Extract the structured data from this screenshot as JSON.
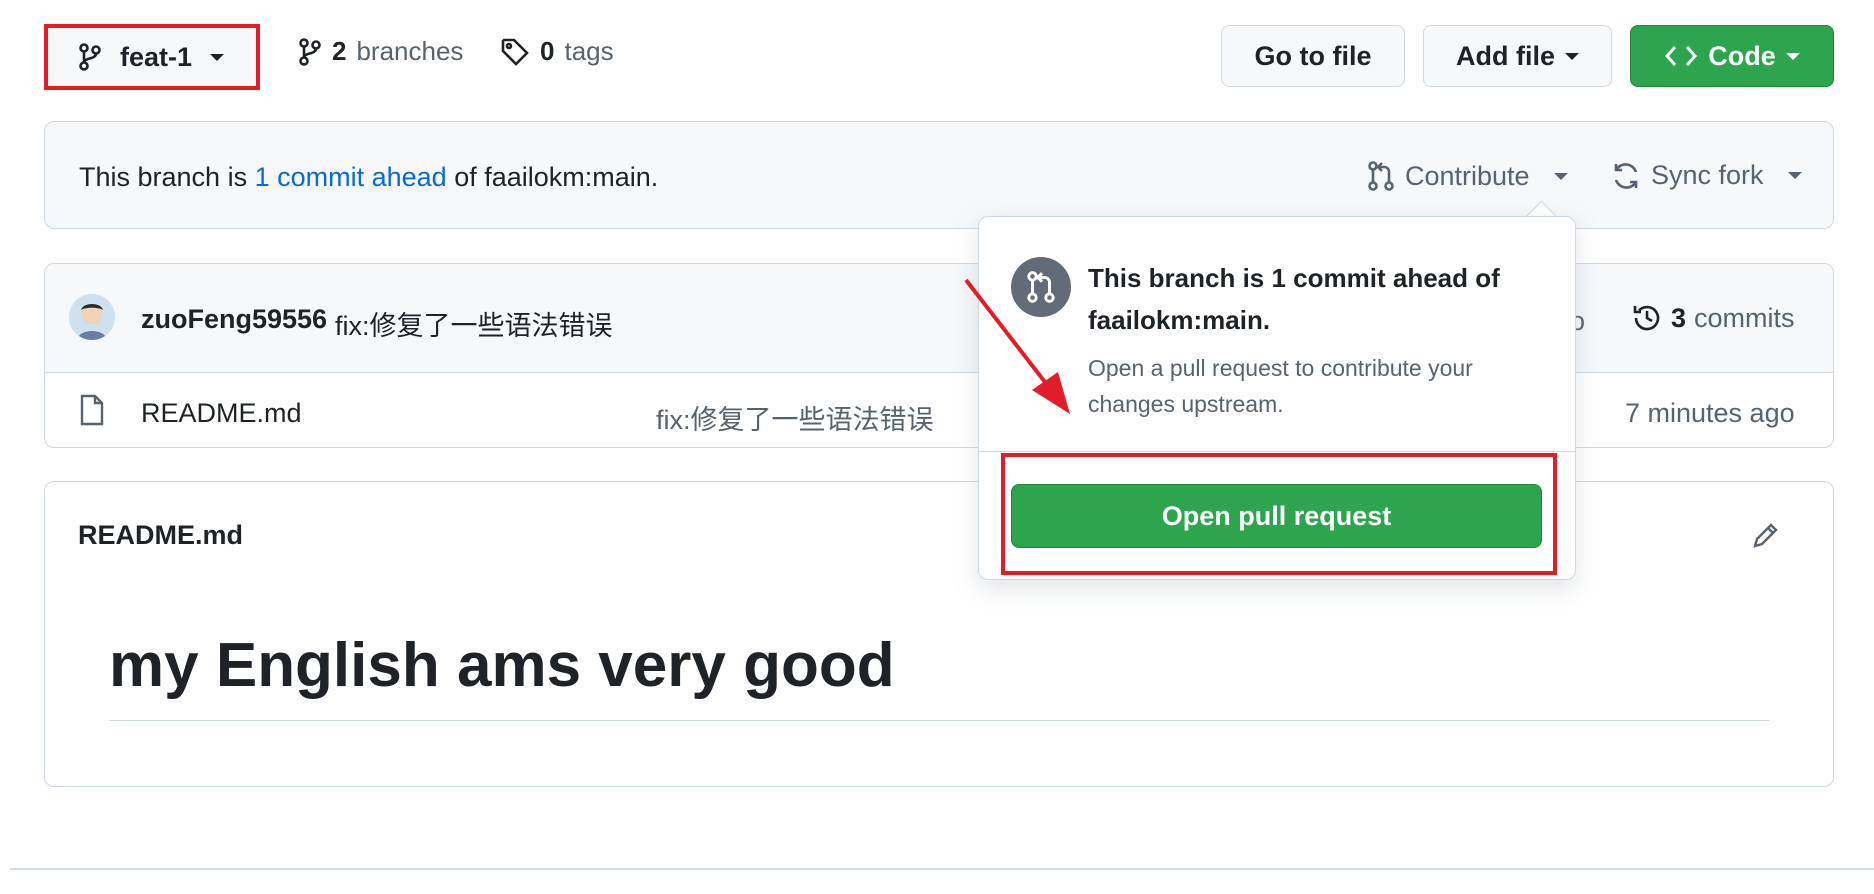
{
  "topbar": {
    "branch_label": "feat-1",
    "branches_count": "2",
    "branches_label": "branches",
    "tags_count": "0",
    "tags_label": "tags",
    "go_to_file": "Go to file",
    "add_file": "Add file",
    "code": "Code"
  },
  "fork_status": {
    "prefix": "This branch is ",
    "link": "1 commit ahead",
    "suffix": " of faailokm:main.",
    "contribute": "Contribute",
    "sync_fork": "Sync fork"
  },
  "latest_commit": {
    "author": "zuoFeng59556",
    "message": "fix:修复了一些语法错误",
    "ago": "go",
    "commits_count": "3",
    "commits_label": "commits"
  },
  "files": [
    {
      "name": "README.md",
      "commit_message": "fix:修复了一些语法错误",
      "time": "7 minutes ago"
    }
  ],
  "readme": {
    "title": "README.md",
    "heading": "my English ams very good"
  },
  "popover": {
    "title": "This branch is 1 commit ahead of faailokm:main.",
    "description": "Open a pull request to contribute your changes upstream.",
    "button": "Open pull request"
  },
  "colors": {
    "accent_green": "#2da44e",
    "link_blue": "#0969da",
    "annotation_red": "#e11d2a"
  }
}
